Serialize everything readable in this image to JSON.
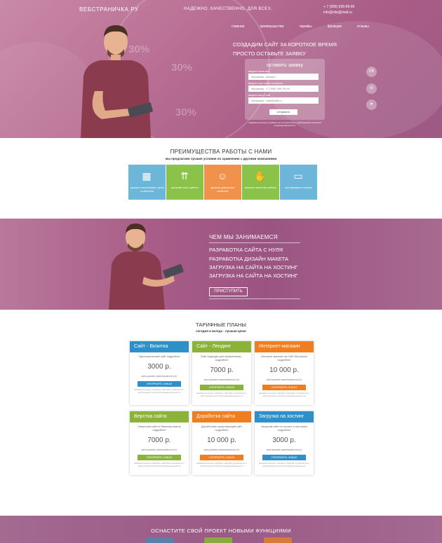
{
  "header": {
    "logo": "ВЕБСТРАНИЧКА.РУ",
    "slogan": "НАДЕЖНО. КАЧЕСТВЕННО. ДЛЯ ВСЕХ.",
    "phone": "+ 7 (999) 999-99-99",
    "email": "info@site@mail.ru"
  },
  "nav": [
    "главная",
    "преимущества",
    "тарифы",
    "функции",
    "отзывы"
  ],
  "hero": {
    "headline1": "СОЗДАДИМ САЙТ ЗА КОРОТКОЕ ВРЕМЯ",
    "headline2": "ПРОСТО ОСТАВЬТЕ ЗАЯВКУ",
    "ghost1": "30%",
    "ghost2": "30%",
    "ghost3": "30%"
  },
  "form": {
    "title": "оставить заявку",
    "name_label": "введите ваше имя",
    "name_placeholder": "например, Михаил",
    "phone_label": "введите ваш номер телефона",
    "phone_placeholder": "например, +7 (999) 999-99-99",
    "email_label": "введите ваш e-mail",
    "email_placeholder": "например, mail@mail.ru",
    "submit": "отправить",
    "note": "нажимая на кнопку отправить вы соглашаетесь с действующей политикой конфиденциальности"
  },
  "social": [
    {
      "icon": "vk-icon",
      "glyph": "VK"
    },
    {
      "icon": "whatsapp-icon",
      "glyph": "☏"
    },
    {
      "icon": "telegram-icon",
      "glyph": "➤"
    }
  ],
  "advantages": {
    "title": "ПРЕИМУЩЕСТВА РАБОТЫ С НАМИ",
    "subtitle": "мы предлагаем лучшие условия по сравнению с другими компаниями",
    "cards": [
      {
        "text": "лучшее соотношение цены и качества",
        "color": "#6cb7d9",
        "icon": "price-quality-icon",
        "glyph": "▦"
      },
      {
        "text": "высокий опыт работы",
        "color": "#8bc34a",
        "icon": "growth-icon",
        "glyph": "⇈"
      },
      {
        "text": "десятки довольных клиентов",
        "color": "#f0914c",
        "icon": "clients-icon",
        "glyph": "☺"
      },
      {
        "text": "высокое качество работы",
        "color": "#8bc34a",
        "icon": "quality-icon",
        "glyph": "✋"
      },
      {
        "text": "все варианты оплаты",
        "color": "#6cb7d9",
        "icon": "payment-icon",
        "glyph": "▭"
      }
    ]
  },
  "whatwedo": {
    "title": "ЧЕМ МЫ ЗАНИМАЕМСЯ",
    "items": [
      "РАЗРАБОТКА САЙТА С НУЛЯ",
      "РАЗРАБОТКА ДИЗАЙН МАКЕТА",
      "ЗАГРУЗКА НА САЙТА НА ХОСТИНГ",
      "ЗАГРУЗКА НА САЙТА НА ХОСТИНГ"
    ],
    "button": "ПРИСТУПИТЬ"
  },
  "pricing": {
    "title": "ТАРИФНЫЕ ПЛАНЫ",
    "subtitle": "сегодня и всегда - лучшая цена!",
    "note": "цена указана ориентировочно (от)",
    "order": "ОФОРМИТЬ ЗАКАЗ",
    "legal": "нажимая на кнопку оформить заказ Вы соглашаетесь с действующей политикой конфиденциальности",
    "plans": [
      {
        "name": "Сайт - Визитка",
        "desc": "Одностраничный сайт подробнее",
        "price": "3000 р.",
        "color": "#2e8fc9",
        "btn": "#2e8fc9"
      },
      {
        "name": "Сайт - Лендинг",
        "desc": "Сайт подходит для привлечения... подробнее",
        "price": "7000 р.",
        "color": "#8bb33a",
        "btn": "#8bb33a"
      },
      {
        "name": "Интернет-магазин",
        "desc": "Интернет магазин на CMS Wordpress подробнее",
        "price": "10 000 р.",
        "color": "#f07d1e",
        "btn": "#f07d1e"
      },
      {
        "name": "Верстка сайта",
        "desc": "Сверстаем сайт по Вашему макету подробнее",
        "price": "7000 р.",
        "color": "#8bb33a",
        "btn": "#8bb33a"
      },
      {
        "name": "Доработка сайта",
        "desc": "Доработаем существующий сайт подробнее",
        "price": "10 000 р.",
        "color": "#f07d1e",
        "btn": "#f07d1e"
      },
      {
        "name": "Загрузка на хостинг",
        "desc": "Загрузим сайт на хостинг и настроим подробнее",
        "price": "3000 р.",
        "color": "#2e8fc9",
        "btn": "#2e8fc9"
      }
    ]
  },
  "features": {
    "title": "ОСНАСТИТЕ СВОЙ ПРОЕКТ НОВЫМИ ФУНКЦИЯМИ"
  }
}
